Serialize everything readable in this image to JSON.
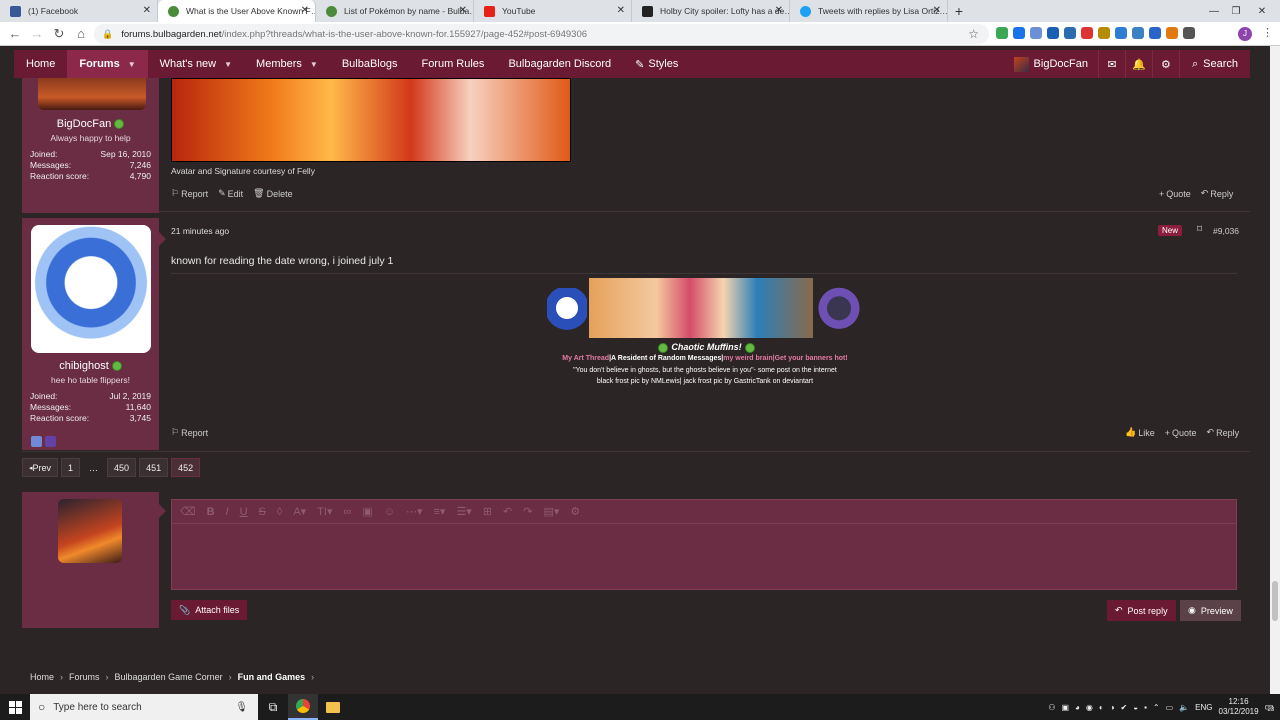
{
  "browser": {
    "tabs": [
      {
        "title": "(1) Facebook",
        "color": "#3b5998"
      },
      {
        "title": "What is the User Above Known F…",
        "color": "#4a8c3a",
        "active": true
      },
      {
        "title": "List of Pokémon by name - Bulba…",
        "color": "#4a8c3a"
      },
      {
        "title": "YouTube",
        "color": "#e62117"
      },
      {
        "title": "Holby City spoiler: Lofty has a de…",
        "color": "#222222"
      },
      {
        "title": "Tweets with replies by Lisa Ortiz…",
        "color": "#1da1f2"
      }
    ],
    "new_tab": "+",
    "url_host": "forums.bulbagarden.net",
    "url_path": "/index.php?threads/what-is-the-user-above-known-for.155927/page-452#post-6949306",
    "profile_initial": "J"
  },
  "sitenav": {
    "items": [
      "Home",
      "Forums",
      "What's new",
      "Members",
      "BulbaBlogs",
      "Forum Rules",
      "Bulbagarden Discord",
      "Styles"
    ],
    "username": "BigDocFan",
    "search": "Search"
  },
  "post1": {
    "username": "BigDocFan",
    "title": "Always happy to help",
    "stats": [
      {
        "label": "Joined:",
        "value": "Sep 16, 2010"
      },
      {
        "label": "Messages:",
        "value": "7,246"
      },
      {
        "label": "Reaction score:",
        "value": "4,790"
      }
    ],
    "signature_note": "Avatar and Signature courtesy of Felly",
    "actions": [
      "Report",
      "Edit",
      "Delete"
    ],
    "right_actions": [
      "Quote",
      "Reply"
    ]
  },
  "post2": {
    "time": "21 minutes ago",
    "badge": "New",
    "number": "#9,036",
    "text": "known for reading the date wrong, i joined july 1",
    "sig_title": "Chaotic Muffins!",
    "sig_links": [
      "My Art Thread",
      "|A Resident of Random Messages|",
      "my weird brain",
      "|Get your banners hot!"
    ],
    "sig_line2": "\"You don't believe in ghosts, but the ghosts believe in you\"- some post on the internet",
    "sig_line3": "black frost pic by NMLewis| jack frost pic by GastricTank on deviantart",
    "username": "chibighost",
    "title": "hee ho table flippers!",
    "stats": [
      {
        "label": "Joined:",
        "value": "Jul 2, 2019"
      },
      {
        "label": "Messages:",
        "value": "11,640"
      },
      {
        "label": "Reaction score:",
        "value": "3,745"
      }
    ],
    "actions": [
      "Report"
    ],
    "right_actions": [
      "Like",
      "Quote",
      "Reply"
    ]
  },
  "pagination": {
    "prev": "Prev",
    "pages": [
      "1",
      "…",
      "450",
      "451",
      "452"
    ],
    "current": "452"
  },
  "reply": {
    "attach": "Attach files",
    "post_reply": "Post reply",
    "preview": "Preview"
  },
  "breadcrumb": [
    "Home",
    "Forums",
    "Bulbagarden Game Corner",
    "Fun and Games"
  ],
  "taskbar": {
    "search_placeholder": "Type here to search",
    "time": "12:16",
    "date": "03/12/2019",
    "lang": "ENG",
    "notif_count": "23"
  }
}
